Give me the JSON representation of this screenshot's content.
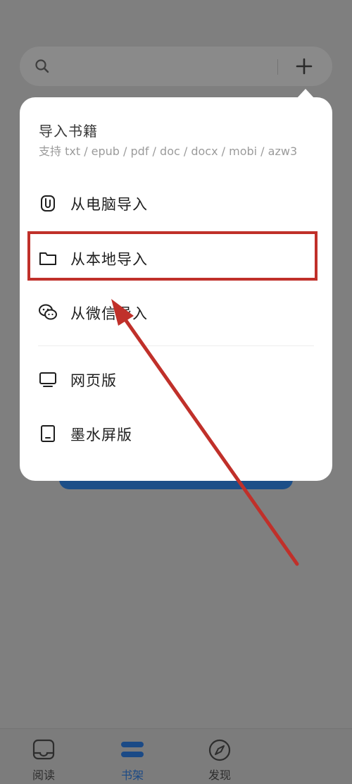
{
  "search": {
    "icon": "search-icon",
    "add_icon": "plus-icon"
  },
  "popup": {
    "title": "导入书籍",
    "subtitle": "支持 txt / epub / pdf / doc / docx / mobi / azw3",
    "items": [
      {
        "label": "从电脑导入",
        "icon": "paperclip-icon"
      },
      {
        "label": "从本地导入",
        "icon": "folder-icon"
      },
      {
        "label": "从微信导入",
        "icon": "wechat-icon"
      },
      {
        "label": "网页版",
        "icon": "monitor-icon"
      },
      {
        "label": "墨水屏版",
        "icon": "tablet-icon"
      }
    ]
  },
  "bottom_nav": {
    "items": [
      {
        "label": "阅读",
        "icon": "reader-icon",
        "active": false
      },
      {
        "label": "书架",
        "icon": "bookshelf-icon",
        "active": true
      },
      {
        "label": "发现",
        "icon": "compass-icon",
        "active": false
      }
    ]
  },
  "colors": {
    "overlay": "#7f7f7f",
    "annotation_red": "#c0302a",
    "accent_blue": "#1b4a86"
  }
}
